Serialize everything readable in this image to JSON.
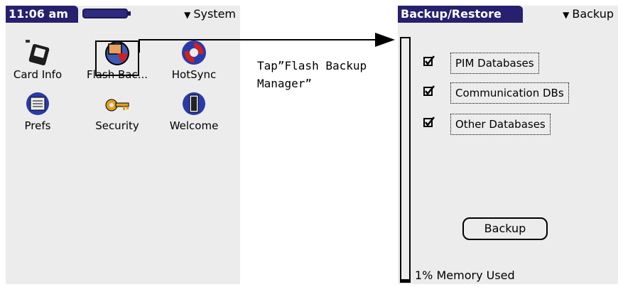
{
  "launcher": {
    "time": "11:06 am",
    "category": "System",
    "apps": [
      {
        "label": "Card Info",
        "icon": "card-info-icon"
      },
      {
        "label": "Flash Bac...",
        "icon": "flash-backup-icon"
      },
      {
        "label": "HotSync",
        "icon": "hotsync-icon"
      },
      {
        "label": "Prefs",
        "icon": "prefs-icon"
      },
      {
        "label": "Security",
        "icon": "security-key-icon"
      },
      {
        "label": "Welcome",
        "icon": "welcome-door-icon"
      }
    ]
  },
  "annotation": {
    "text": "Tap”Flash Backup\nManager”"
  },
  "backup_form": {
    "title": "Backup/Restore",
    "mode": "Backup",
    "checkboxes": [
      {
        "label": "PIM Databases",
        "checked": true
      },
      {
        "label": "Communication DBs",
        "checked": true
      },
      {
        "label": "Other Databases",
        "checked": true
      }
    ],
    "backup_button": "Backup",
    "memory_text": "1% Memory Used",
    "memory_used_fraction": 0.01
  },
  "colors": {
    "titlebar": "#26206e",
    "screen_bg": "#ececec"
  }
}
